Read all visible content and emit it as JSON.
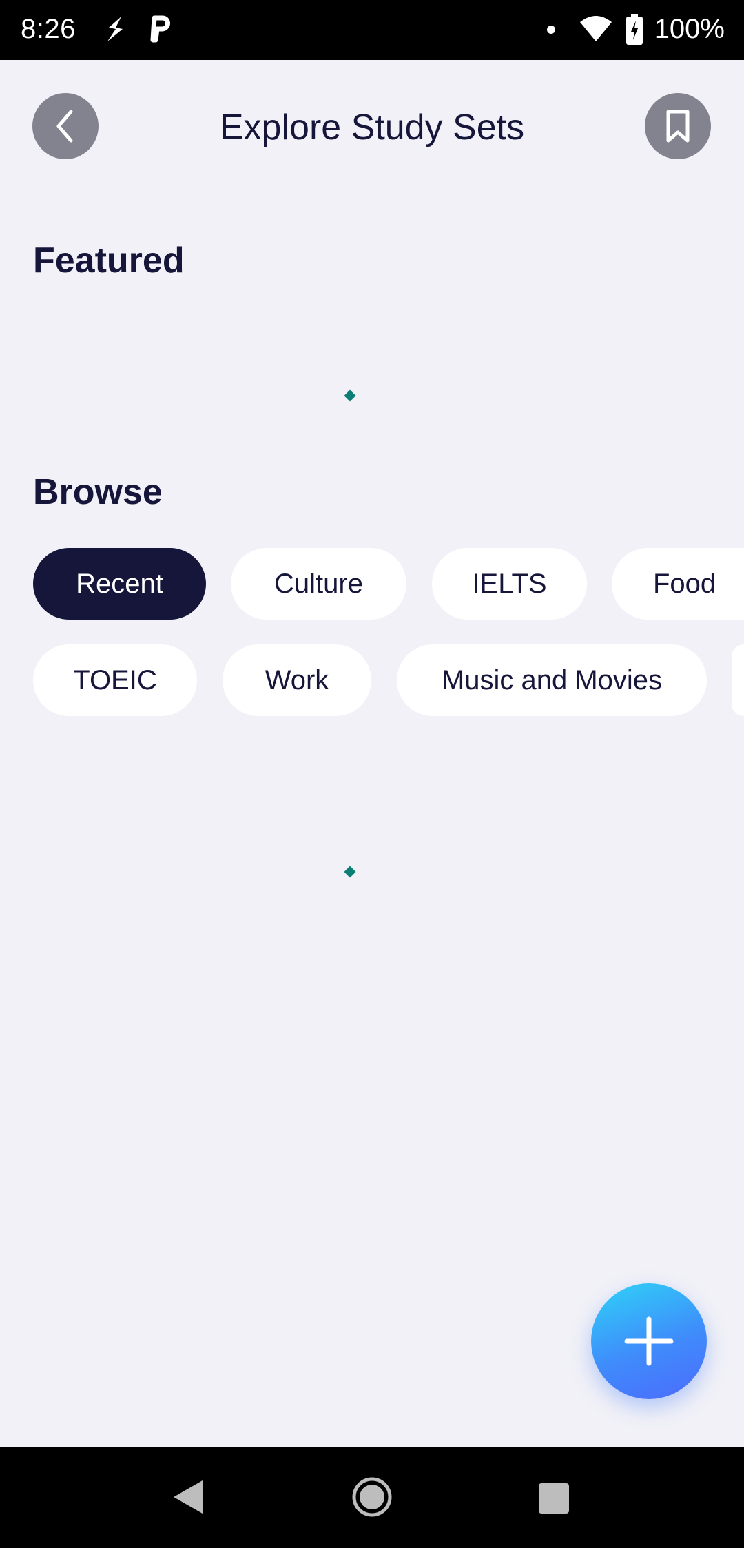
{
  "status_bar": {
    "time": "8:26",
    "battery": "100%",
    "icons": [
      "s-app-icon",
      "p-app-icon",
      "notification-dot-icon",
      "wifi-icon",
      "battery-icon"
    ]
  },
  "header": {
    "title": "Explore Study Sets",
    "back_icon": "chevron-left-icon",
    "bookmark_icon": "bookmark-icon",
    "button_color": "#838390"
  },
  "sections": {
    "featured": "Featured",
    "browse": "Browse"
  },
  "browse_chips": {
    "row1": [
      "Recent",
      "Culture",
      "IELTS",
      "Food"
    ],
    "row2": [
      "TOEIC",
      "Work",
      "Music and Movies"
    ],
    "active": "Recent"
  },
  "fab": {
    "icon": "plus-icon"
  },
  "colors": {
    "background": "#F1F1F7",
    "text_dark": "#15163A",
    "chip_active": "#15163A",
    "chip_inactive": "#FFFFFF",
    "spinner": "#0B7F73",
    "fab_gradient_start": "#2FD3F7",
    "fab_gradient_end": "#4C6BFC"
  },
  "nav_bar": {
    "icons": [
      "back-triangle-icon",
      "home-circle-icon",
      "recents-square-icon"
    ]
  }
}
